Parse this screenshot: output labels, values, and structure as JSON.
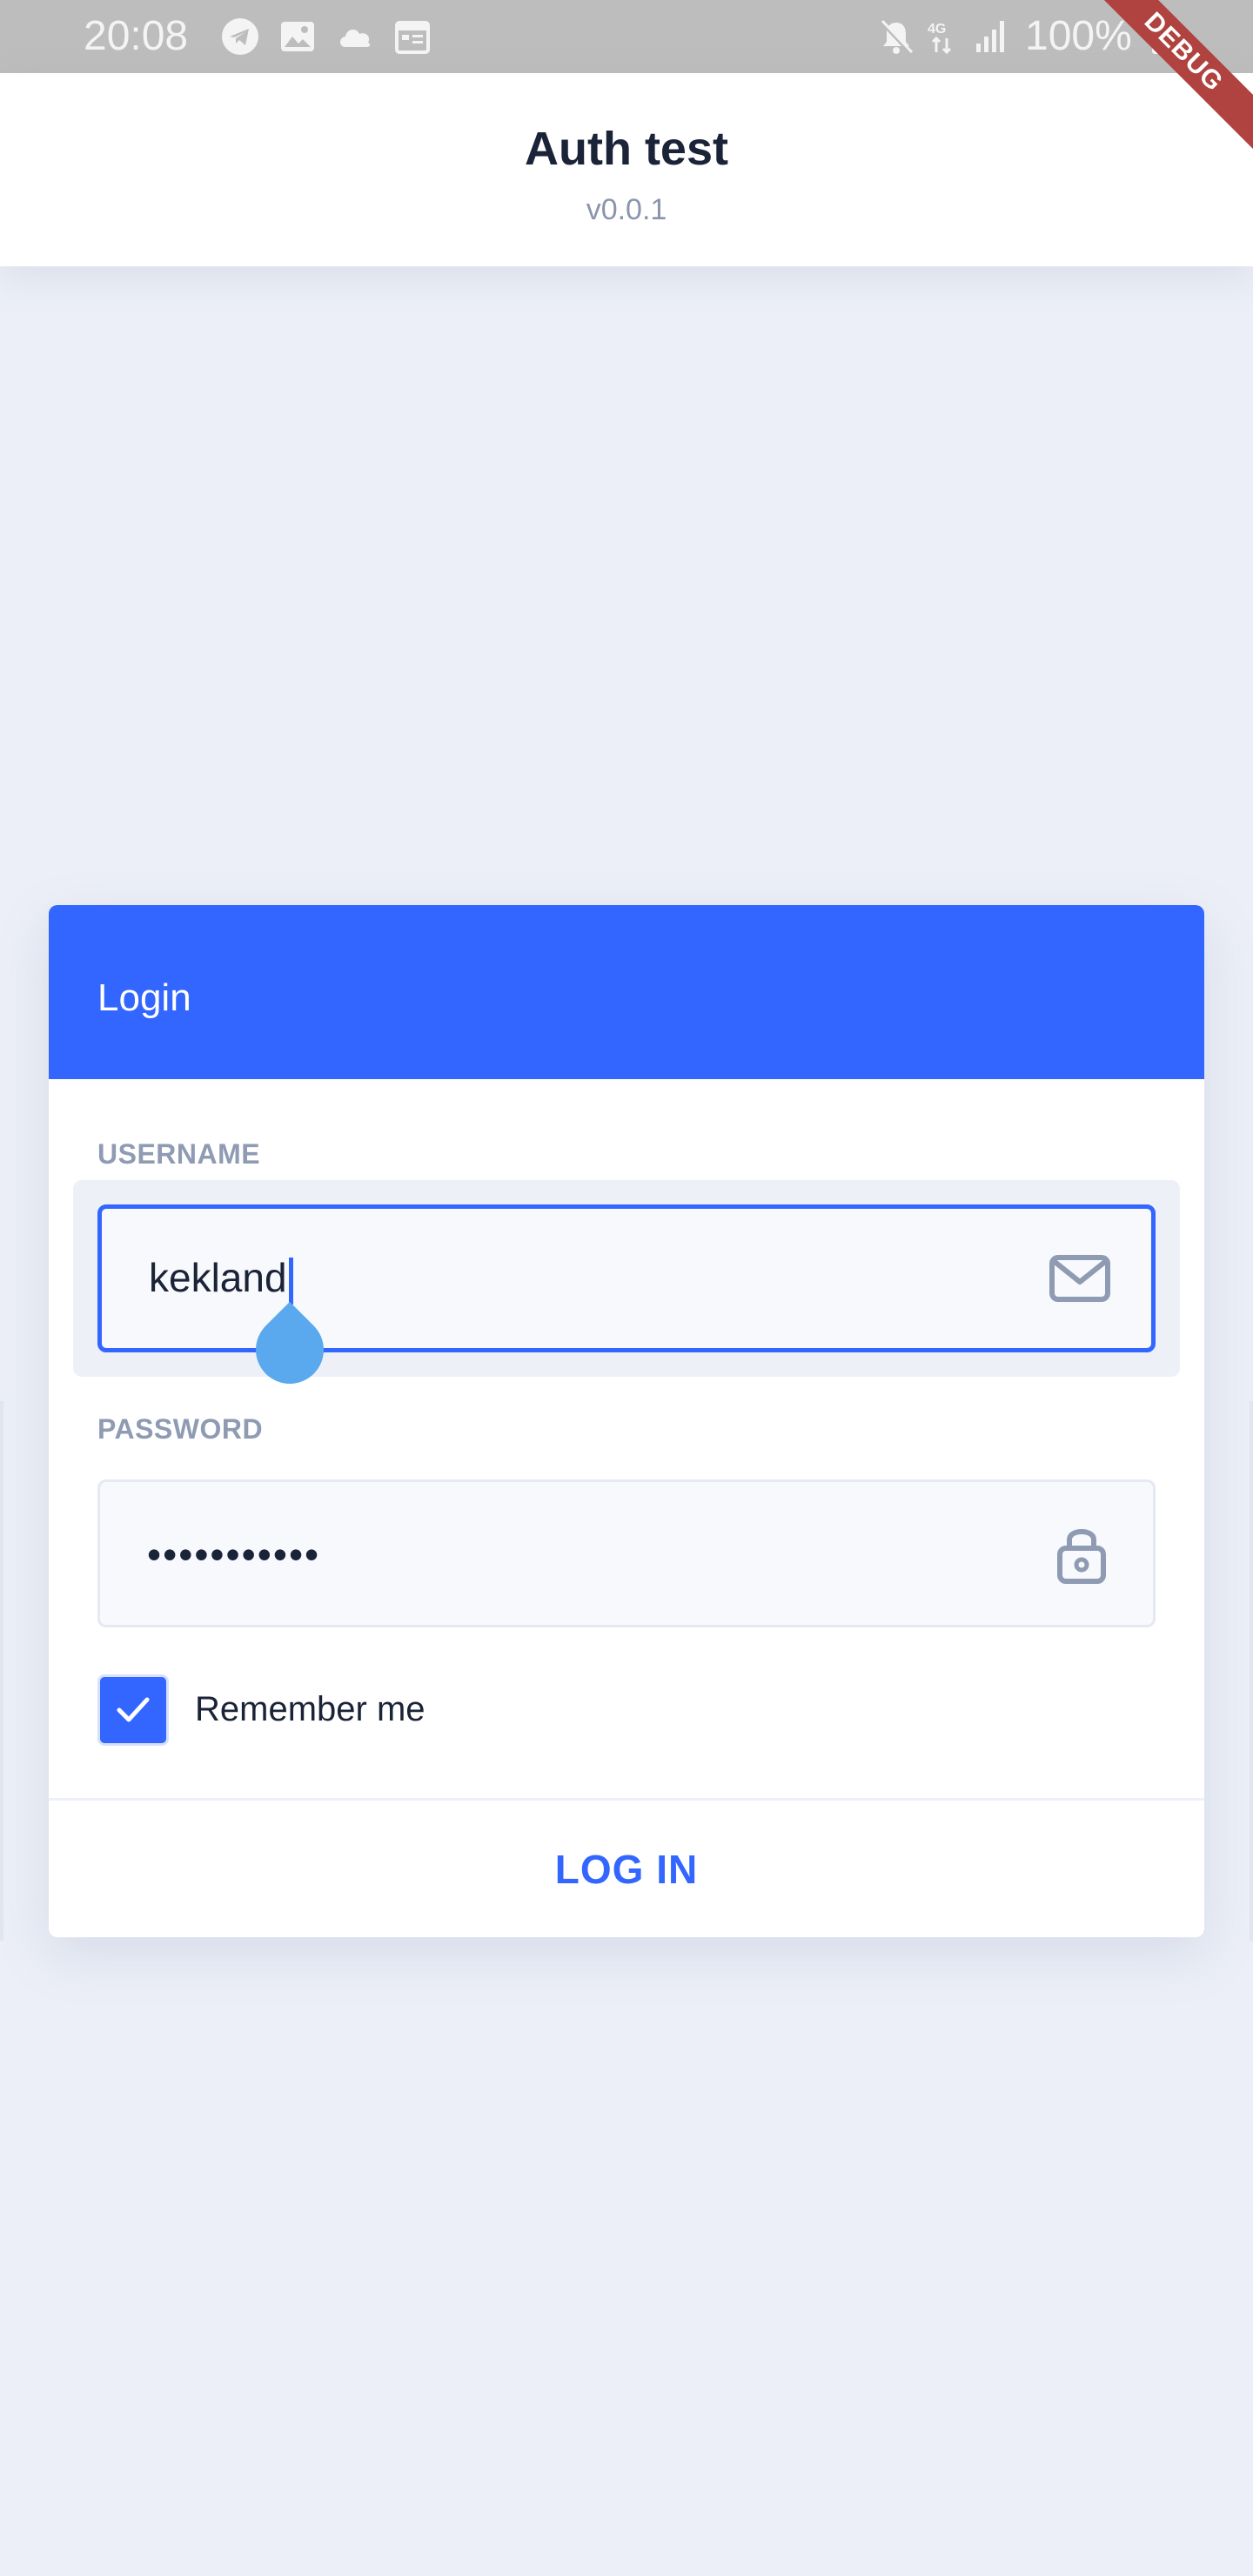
{
  "status_bar": {
    "time": "20:08",
    "battery": "100%",
    "icons": [
      "telegram-icon",
      "image-icon",
      "cloud-icon",
      "calendar-icon",
      "mute-icon",
      "network-4g-icon",
      "signal-icon",
      "battery-icon"
    ]
  },
  "debug_banner": "DEBUG",
  "app_bar": {
    "title": "Auth test",
    "version": "v0.0.1"
  },
  "login_card": {
    "header": "Login",
    "username": {
      "label": "USERNAME",
      "value": "kekland",
      "icon": "mail-icon"
    },
    "password": {
      "label": "PASSWORD",
      "value": "•••••••••••",
      "icon": "lock-icon"
    },
    "remember_me": {
      "label": "Remember me",
      "checked": true
    },
    "submit_label": "LOG IN"
  },
  "colors": {
    "primary": "#3366ff",
    "background": "#eceff7",
    "text_dark": "#1b2338",
    "label_grey": "#8f9bb3",
    "status_bar": "#bdbdbd",
    "debug_ribbon": "#b0423f",
    "handle": "#5aa9ee"
  }
}
